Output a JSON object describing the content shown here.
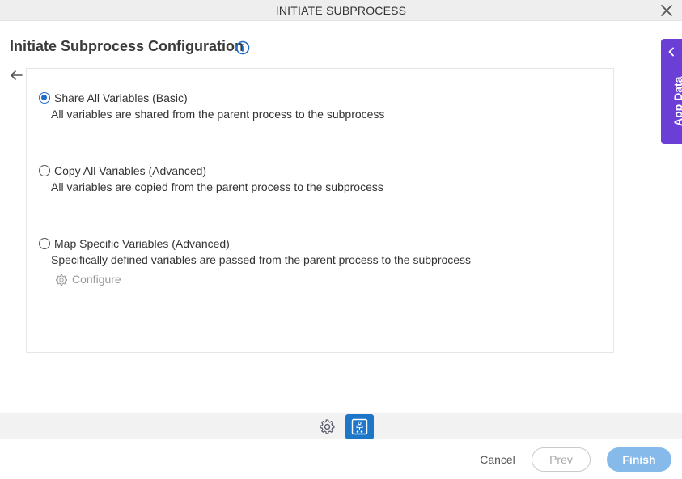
{
  "window": {
    "title": "INITIATE SUBPROCESS",
    "close_icon": "close-icon"
  },
  "page": {
    "heading": "Initiate Subprocess Configuration",
    "info_icon": "info-icon",
    "back_icon": "arrow-left-icon"
  },
  "options": [
    {
      "label": "Share All Variables (Basic)",
      "description": "All variables are shared from the parent process to the subprocess",
      "selected": true
    },
    {
      "label": "Copy All Variables (Advanced)",
      "description": "All variables are copied from the parent process to the subprocess",
      "selected": false
    },
    {
      "label": "Map Specific Variables (Advanced)",
      "description": "Specifically defined variables are passed from the parent process to the subprocess",
      "selected": false
    }
  ],
  "configure": {
    "label": "Configure",
    "icon": "gear-icon"
  },
  "app_data": {
    "label": "App Data",
    "icon": "chevron-left-icon",
    "color": "#6b3fd6"
  },
  "toolbar": {
    "settings_icon": "gear-icon",
    "flow_icon": "subprocess-flow-icon",
    "active_color": "#1e76c9"
  },
  "footer": {
    "cancel_label": "Cancel",
    "prev_label": "Prev",
    "finish_label": "Finish",
    "finish_color": "#86baea"
  }
}
